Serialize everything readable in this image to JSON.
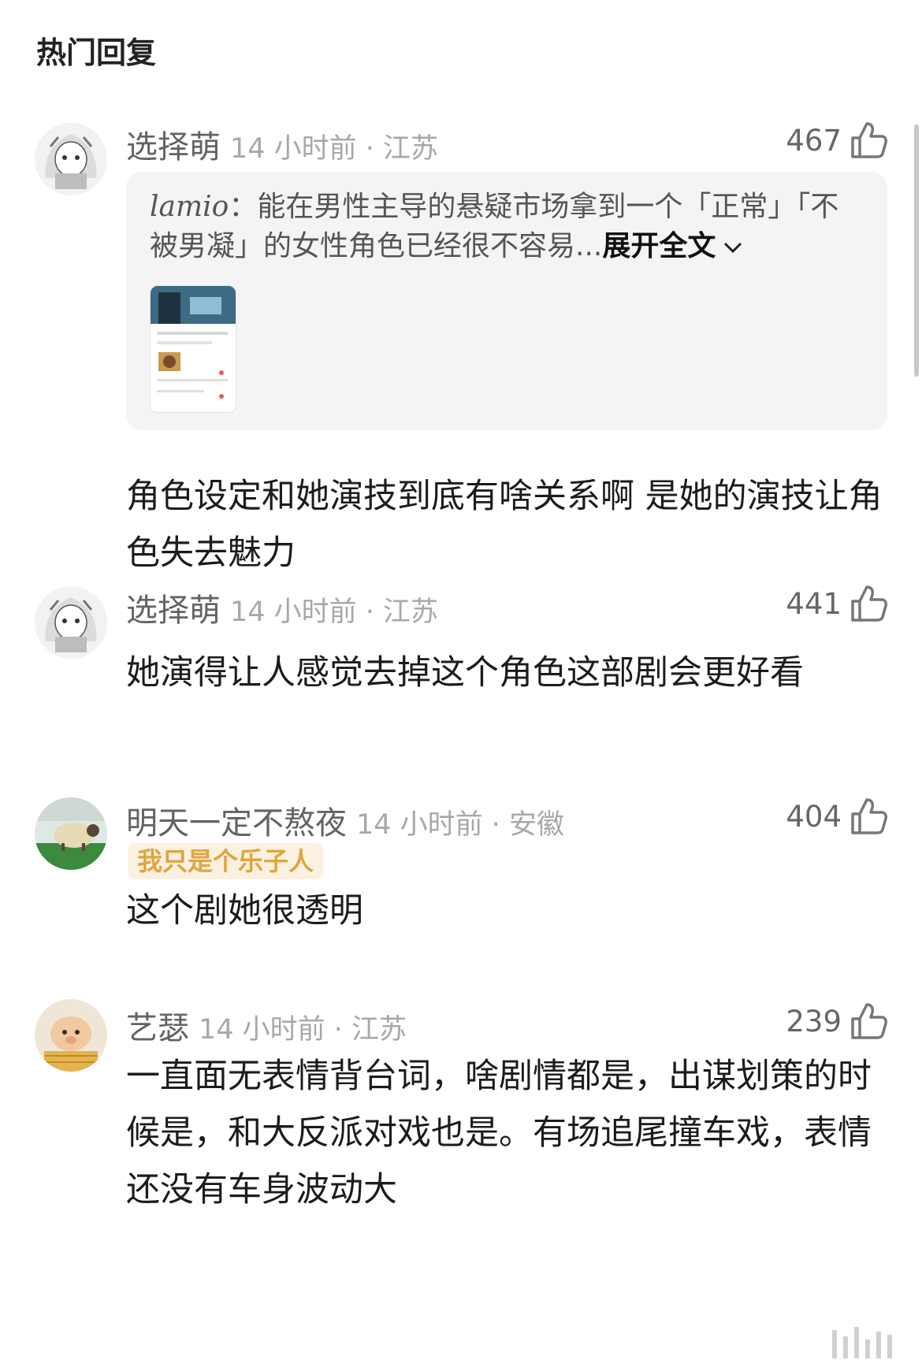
{
  "section": {
    "title": "热门回复"
  },
  "comments": [
    {
      "username": "选择萌",
      "meta": "14 小时前 · 江苏",
      "likes": "467",
      "quote": {
        "author": "lamio",
        "separator": "：",
        "text": "能在男性主导的悬疑市场拿到一个「正常」「不被男凝」的女性角色已经很不容易...",
        "expand_label": "展开全文"
      },
      "text": "角色设定和她演技到底有啥关系啊 是她的演技让角色失去魅力"
    },
    {
      "username": "选择萌",
      "meta": "14 小时前 · 江苏",
      "likes": "441",
      "text": "她演得让人感觉去掉这个角色这部剧会更好看"
    },
    {
      "username": "明天一定不熬夜",
      "meta": "14 小时前 · 安徽",
      "likes": "404",
      "badge": "我只是个乐子人",
      "text": "这个剧她很透明"
    },
    {
      "username": "艺瑟",
      "meta": "14 小时前 · 江苏",
      "likes": "239",
      "text": "一直面无表情背台词，啥剧情都是，出谋划策的时候是，和大反派对戏也是。有场追尾撞车戏，表情还没有车身波动大"
    }
  ],
  "icons": {
    "like": "thumbs-up-icon",
    "expand": "chevron-down-icon"
  }
}
